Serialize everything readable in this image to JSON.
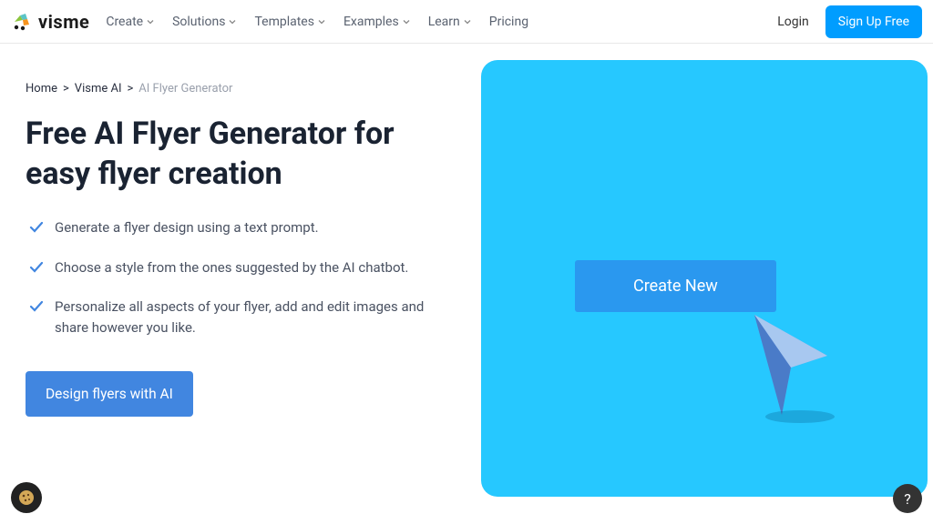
{
  "header": {
    "logo_text": "visme",
    "nav": [
      {
        "label": "Create",
        "has_dropdown": true
      },
      {
        "label": "Solutions",
        "has_dropdown": true
      },
      {
        "label": "Templates",
        "has_dropdown": true
      },
      {
        "label": "Examples",
        "has_dropdown": true
      },
      {
        "label": "Learn",
        "has_dropdown": true
      },
      {
        "label": "Pricing",
        "has_dropdown": false
      }
    ],
    "login_label": "Login",
    "signup_label": "Sign Up Free"
  },
  "breadcrumb": {
    "items": [
      "Home",
      "Visme AI"
    ],
    "current": "AI Flyer Generator"
  },
  "hero": {
    "title": "Free AI Flyer Generator for easy flyer creation",
    "features": [
      "Generate a flyer design using a text prompt.",
      "Choose a style from the ones suggested by the AI chatbot.",
      "Personalize all aspects of your flyer, add and edit images and share however you like."
    ],
    "cta_label": "Design flyers with AI"
  },
  "illustration": {
    "create_label": "Create New"
  },
  "help_label": "?"
}
